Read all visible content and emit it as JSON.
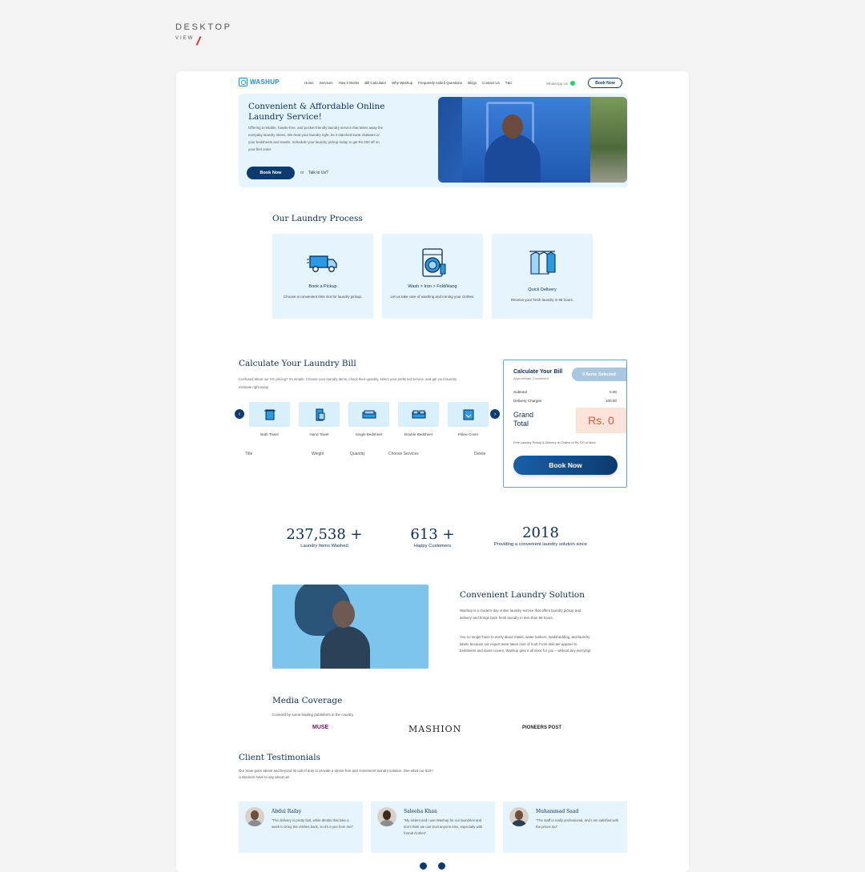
{
  "page_label": {
    "title": "DESKTOP",
    "sub": "VIEW"
  },
  "site": {
    "logo": "WASHUP",
    "nav": [
      "Home",
      "Services",
      "How it Works",
      "Bill Calculator",
      "Why Washup",
      "Frequently Asked Questions",
      "Blogs",
      "Contact Us",
      "T&C"
    ],
    "whatsapp": "WhatsApp Us",
    "nav_book": "Book Now"
  },
  "hero": {
    "title": "Convenient & Affordable Online Laundry Service!",
    "text": "Offering a reliable, hassle-free, and pocket-friendly laundry service that takes away the everyday laundry stress. We treat your laundry right, be it starched kurta shalwars or your bedsheets and towels. Schedule your laundry pickup today to get Rs.200 off on your first order.",
    "book": "Book Now",
    "or": "or",
    "talk": "Talk to Us?"
  },
  "process": {
    "title": "Our Laundry Process",
    "steps": [
      {
        "icon": "truck-icon",
        "title": "Book a Pickup",
        "desc": "Choose a convenient time slot for laundry pickup."
      },
      {
        "icon": "washing-machine-icon",
        "title": "Wash > Iron > Fold/Hang",
        "desc": "Let us take care of washing and ironing your clothes."
      },
      {
        "icon": "hanging-clothes-icon",
        "title": "Quick Delivery",
        "desc": "Receive your fresh laundry in 96 hours."
      }
    ]
  },
  "calculator": {
    "title": "Calculate Your Laundry Bill",
    "text": "Confused about our KG pricing? It's simple. Choose your laundry items, check their quantity, select your preferred service, and get your laundry estimate right away.",
    "items": [
      {
        "label": "Bath Towel",
        "icon": "towel-icon"
      },
      {
        "label": "Hand Towel",
        "icon": "hand-towel-icon"
      },
      {
        "label": "Single Bedsheet",
        "icon": "single-bed-icon"
      },
      {
        "label": "Double Bedsheet",
        "icon": "double-bed-icon"
      },
      {
        "label": "Pillow Cover",
        "icon": "pillow-icon"
      }
    ],
    "columns": [
      "Title",
      "Weight",
      "Quantity",
      "Choose Services",
      "Delete"
    ],
    "summary": {
      "title": "Calculate Your Bill",
      "subtitle": "Approximate Convenient",
      "chip": "0 Items Selected",
      "subtotal_label": "Subtotal",
      "subtotal": "0.00",
      "delivery_label": "Delivery Charges",
      "delivery": "100.00",
      "grand_label_1": "Grand",
      "grand_label_2": "Total",
      "grand_value": "Rs. 0",
      "free_note": "Free Laundry Pickup & Delivery on Orders of Rs.700 or More",
      "book": "Book Now"
    }
  },
  "stats": [
    {
      "value": "237,538 +",
      "label": "Laundry Items Washed"
    },
    {
      "value": "613 +",
      "label": "Happy Customers"
    },
    {
      "value": "2018",
      "label": "Providing a convenient laundry solution since"
    }
  ],
  "solution": {
    "title": "Convenient Laundry Solution",
    "p1": "Washup is a modern-day online laundry service that offers laundry pickup and delivery and brings back fresh laundry in less than 96 hours.",
    "p2": "You no longer have to worry about maids, water tankers, loadshedding, and laundry labels because our expert team takes care of it all. From delicate apparel to bedsheets and duvet covers, Washup gets it all done for you – without any worrying!"
  },
  "media": {
    "title": "Media Coverage",
    "subtitle": "Covered by some leading publishers in the country.",
    "logos": [
      "MUSE",
      "MASHION",
      "PIONEERS POST"
    ]
  },
  "testimonials": {
    "title": "Client Testimonials",
    "subtitle": "Our team goes above and beyond its call of duty to provide a stress-free and convenient laundry solution. See what our 610+ customers have to say about us!",
    "items": [
      {
        "name": "Abdul Rafay",
        "quote": "\"The delivery is pretty fast, while dhobis that take a week to bring the clothes back, so it's a yes from me!\""
      },
      {
        "name": "Saleeha Khan",
        "quote": "\"My sisters and I use Washup for our laundries and don't think we can trust anyone else, especially with formal clothes\""
      },
      {
        "name": "Muhammad Saad",
        "quote": "\"The staff is really professional, and I am satisfied with the prices too\""
      }
    ]
  }
}
